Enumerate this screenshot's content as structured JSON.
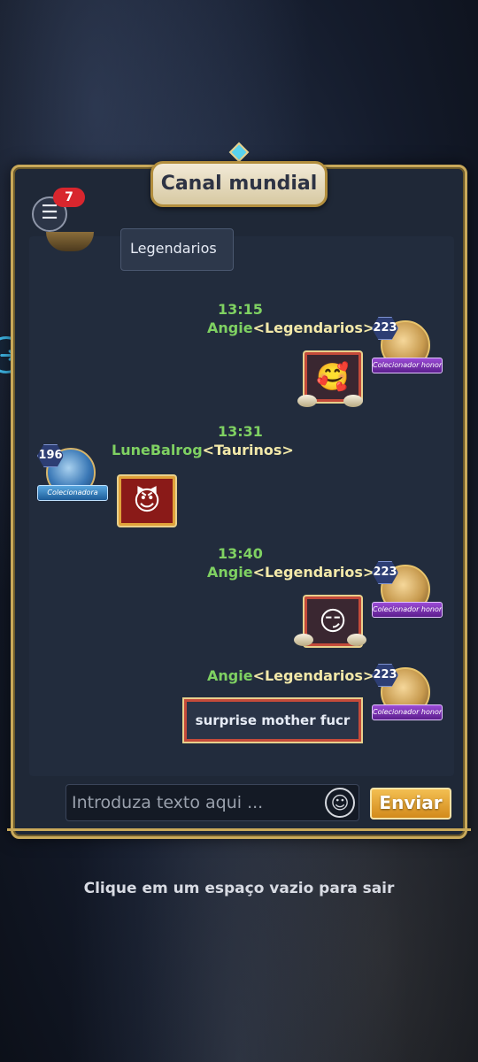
{
  "header": {
    "title": "Canal mundial",
    "unread_count": "7"
  },
  "chat": {
    "top_bubble_text": "Legendarios",
    "messages": [
      {
        "time": "13:15",
        "name": "Angie",
        "guild": "<Legendarios>",
        "level": "223",
        "banner": "Colecionador honorário",
        "sticker": "🥰"
      },
      {
        "time": "13:31",
        "name": "LuneBalrog",
        "guild": "<Taurinos>",
        "level": "196",
        "banner": "Colecionadora",
        "sticker": "😈"
      },
      {
        "time": "13:40",
        "name": "Angie",
        "guild": "<Legendarios>",
        "level": "223",
        "banner": "Colecionador honorário",
        "sticker": "😏"
      },
      {
        "name": "Angie",
        "guild": "<Legendarios>",
        "level": "223",
        "banner": "Colecionador honorário",
        "text": "surprise mother fucr"
      }
    ]
  },
  "input": {
    "placeholder": "Introduza texto aqui ...",
    "value": ""
  },
  "buttons": {
    "send": "Enviar"
  },
  "hint": "Clique em um espaço vazio para sair",
  "icons": {
    "menu": "menu-icon",
    "emoji": "emoji-icon",
    "side": "arrow-right-icon"
  }
}
